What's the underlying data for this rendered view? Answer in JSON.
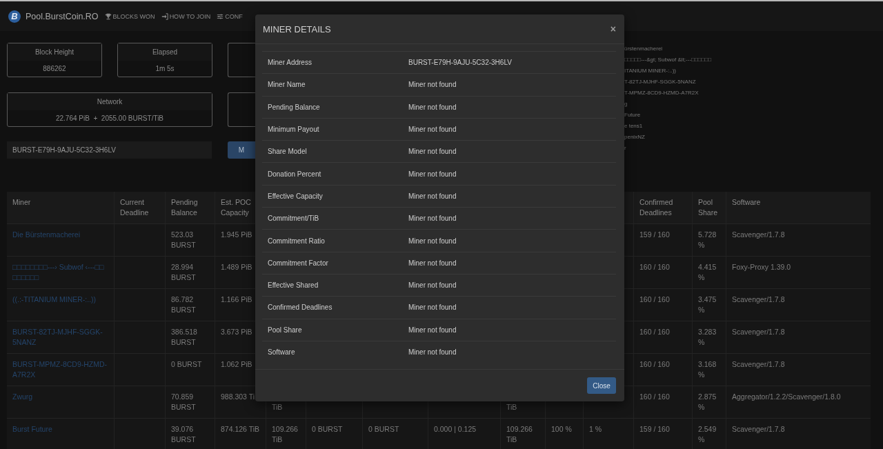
{
  "nav": {
    "logo_letter": "B",
    "brand": "Pool.BurstCoin.RO",
    "links": [
      {
        "label": "BLOCKS WON",
        "kind": "trophy"
      },
      {
        "label": "HOW TO JOIN",
        "kind": "signin"
      },
      {
        "label": "CONF",
        "kind": "sliders"
      }
    ]
  },
  "stats": [
    {
      "label": "Block Height",
      "value": "886262"
    },
    {
      "label": "Elapsed",
      "value": "1m 5s"
    }
  ],
  "network": {
    "label": "Network",
    "value": "22.764 PiB  +  2055.00 BURST/TiB"
  },
  "address_field": {
    "value": "BURST-E79H-9AJU-5C32-3H6LV"
  },
  "lookup_button": {
    "label": "M"
  },
  "recent_miners": [
    {
      "text": "ürstenmacherei"
    },
    {
      "text": "□□□□□---&gt; Subwof &lt;---□□□□□□"
    },
    {
      "text": "ITANIUM MINER-:..))"
    },
    {
      "text": "T-82TJ-MJHF-SGGK-5NANZ"
    },
    {
      "text": "T-MPMZ-8CD9-HZMD-A7R2X"
    },
    {
      "text": "g"
    },
    {
      "text": "Future"
    },
    {
      "text": "e tens1"
    },
    {
      "text": "penixNZ"
    },
    {
      "text": "r"
    }
  ],
  "table": {
    "columns": {
      "miner": "Miner",
      "current_deadline": "Current Deadline",
      "pending_balance": "Pending Balance",
      "est_poc_capacity": "Est. POC Capacity",
      "confirmed_deadlines": "Confirmed Deadlines",
      "pool_share": "Pool Share",
      "software": "Software"
    },
    "rows": [
      {
        "miner": "Die Bürstenmacherei",
        "pending_balance": "523.03 BURST",
        "est_poc_capacity": "1.945 PiB",
        "confirmed_deadlines": "159 / 160",
        "pool_share": "5.728 %",
        "software": "Scavenger/1.7.8"
      },
      {
        "miner": "□□□□□□□□---› Subwof ‹---□□ □□□□□□",
        "pending_balance": "28.994 BURST",
        "est_poc_capacity": "1.489 PiB",
        "confirmed_deadlines": "160 / 160",
        "pool_share": "4.415 %",
        "software": "Foxy-Proxy 1.39.0"
      },
      {
        "miner": "((.:-TITANIUM MINER-:..))",
        "pending_balance": "86.782 BURST",
        "est_poc_capacity": "1.166 PiB",
        "confirmed_deadlines": "160 / 160",
        "pool_share": "3.475 %",
        "software": "Scavenger/1.7.8"
      },
      {
        "miner": "BURST-82TJ-MJHF-SGGK-5NANZ",
        "pending_balance": "386.518 BURST",
        "est_poc_capacity": "3.673 PiB",
        "confirmed_deadlines": "160 / 160",
        "pool_share": "3.283 %",
        "software": "Scavenger/1.7.8"
      },
      {
        "miner": "BURST-MPMZ-8CD9-HZMD-A7R2X",
        "pending_balance": "0 BURST",
        "est_poc_capacity": "1.062 PiB",
        "confirmed_deadlines": "160 / 160",
        "pool_share": "3.168 %",
        "software": "Scavenger/1.7.8"
      },
      {
        "miner": "Zwurg",
        "pending_balance": "70.859 BURST",
        "est_poc_capacity": "988.303 Ti",
        "column_5": {
          "text": "TiB",
          "cut_top": true
        },
        "column_9": {
          "text": "TiB",
          "cut_top": true
        },
        "confirmed_deadlines": "160 / 160",
        "pool_share": "2.875 %",
        "software": "Aggregator/1.2.2/Scavenger/1.8.0"
      },
      {
        "miner": "Burst Future",
        "pending_balance": "39.076 BURST",
        "est_poc_capacity": "874.126 TiB",
        "column_5": "109.266 TiB",
        "column_6": "0 BURST",
        "column_7": "0 BURST",
        "column_8": "0.000 | 0.125",
        "column_9": "109.266 TiB",
        "column_10": "100 %",
        "column_11": "1 %",
        "confirmed_deadlines": "159 / 160",
        "pool_share": "2.549 %",
        "software": "Scavenger/1.7.8"
      }
    ]
  },
  "modal": {
    "title": "MINER DETAILS",
    "close_icon": "×",
    "rows": [
      {
        "label": "Miner Address",
        "value": "BURST-E79H-9AJU-5C32-3H6LV"
      },
      {
        "label": "Miner Name",
        "value": "Miner not found"
      },
      {
        "label": "Pending Balance",
        "value": "Miner not found"
      },
      {
        "label": "Minimum Payout",
        "value": "Miner not found"
      },
      {
        "label": "Share Model",
        "value": "Miner not found"
      },
      {
        "label": "Donation Percent",
        "value": "Miner not found"
      },
      {
        "label": "Effective Capacity",
        "value": "Miner not found"
      },
      {
        "label": "Commitment/TiB",
        "value": "Miner not found"
      },
      {
        "label": "Commitment Ratio",
        "value": "Miner not found"
      },
      {
        "label": "Commitment Factor",
        "value": "Miner not found"
      },
      {
        "label": "Effective Shared",
        "value": "Miner not found"
      },
      {
        "label": "Confirmed Deadlines",
        "value": "Miner not found"
      },
      {
        "label": "Pool Share",
        "value": "Miner not found"
      },
      {
        "label": "Software",
        "value": "Miner not found"
      }
    ],
    "button": "Close"
  }
}
